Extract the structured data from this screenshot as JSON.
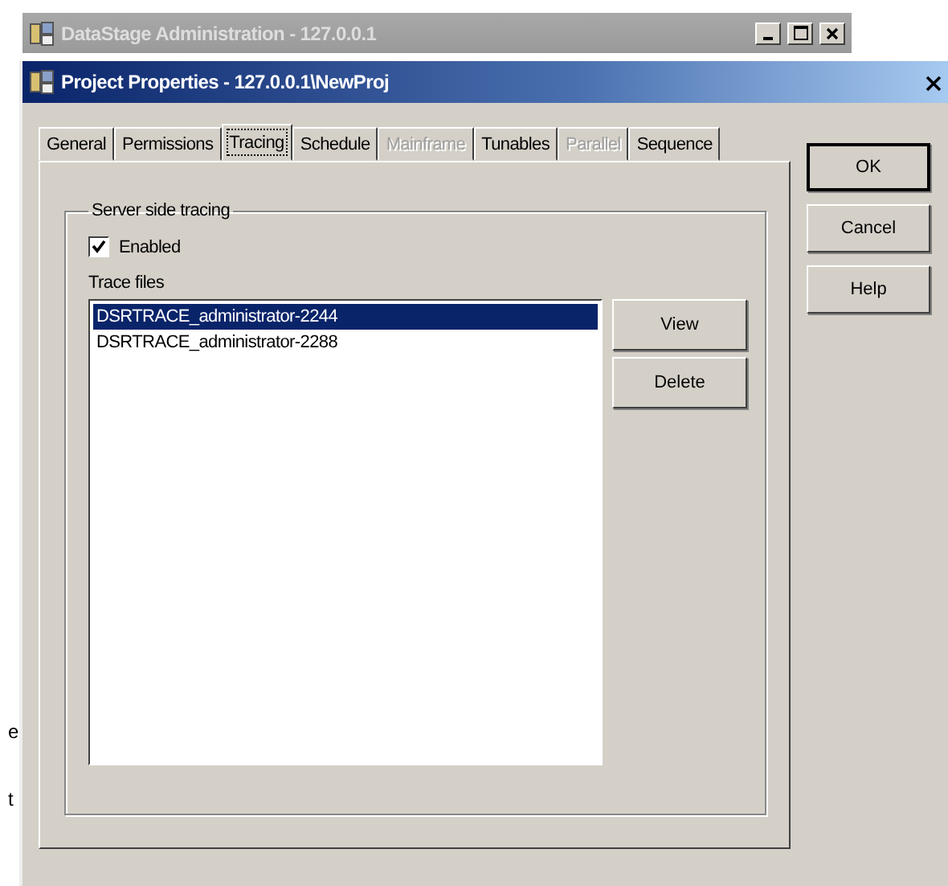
{
  "background_window": {
    "title": "DataStage Administration - 127.0.0.1",
    "fragments": [
      "e",
      "t"
    ]
  },
  "dialog": {
    "title": "Project Properties - 127.0.0.1\\NewProj"
  },
  "tabs": [
    {
      "label": "General",
      "selected": false,
      "disabled": false
    },
    {
      "label": "Permissions",
      "selected": false,
      "disabled": false
    },
    {
      "label": "Tracing",
      "selected": true,
      "disabled": false
    },
    {
      "label": "Schedule",
      "selected": false,
      "disabled": false
    },
    {
      "label": "Mainframe",
      "selected": false,
      "disabled": true
    },
    {
      "label": "Tunables",
      "selected": false,
      "disabled": false
    },
    {
      "label": "Parallel",
      "selected": false,
      "disabled": true
    },
    {
      "label": "Sequence",
      "selected": false,
      "disabled": false
    }
  ],
  "group": {
    "title": "Server side tracing",
    "enabled": {
      "label": "Enabled",
      "checked": true
    },
    "list_label": "Trace files",
    "files": [
      {
        "name": "DSRTRACE_administrator-2244",
        "selected": true
      },
      {
        "name": "DSRTRACE_administrator-2288",
        "selected": false
      }
    ],
    "buttons": [
      "View",
      "Delete"
    ]
  },
  "dialog_buttons": [
    "OK",
    "Cancel",
    "Help"
  ]
}
